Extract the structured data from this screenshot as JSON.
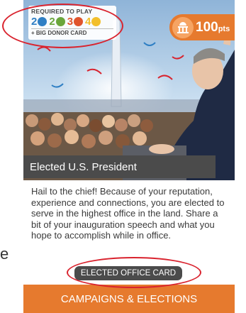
{
  "stray_text": "e",
  "card": {
    "requirements": {
      "title": "REQUIRED TO PLAY",
      "items": [
        {
          "count": "2",
          "color": "#2f7fc4",
          "icon": "blue-token-icon"
        },
        {
          "count": "2",
          "color": "#6aa63b",
          "icon": "green-token-icon"
        },
        {
          "count": "3",
          "color": "#e0542c",
          "icon": "red-token-icon"
        },
        {
          "count": "4",
          "color": "#f2bf2b",
          "icon": "yellow-token-icon"
        }
      ],
      "extra": "+ BIG DONOR CARD"
    },
    "points": {
      "value": "100",
      "unit": "pts"
    },
    "title": "Elected U.S. President",
    "description": "Hail to the chief! Because of your reputation, experience and connections, you are elected to serve in the highest office in the land. Share a bit of your inauguration speech and what you hope to accomplish while in office.",
    "card_type": "ELECTED OFFICE CARD",
    "category": "CAMPAIGNS & ELECTIONS"
  },
  "colors": {
    "accent": "#e67a2e",
    "dark": "#4b4b4b",
    "annotation": "#d9232e"
  }
}
